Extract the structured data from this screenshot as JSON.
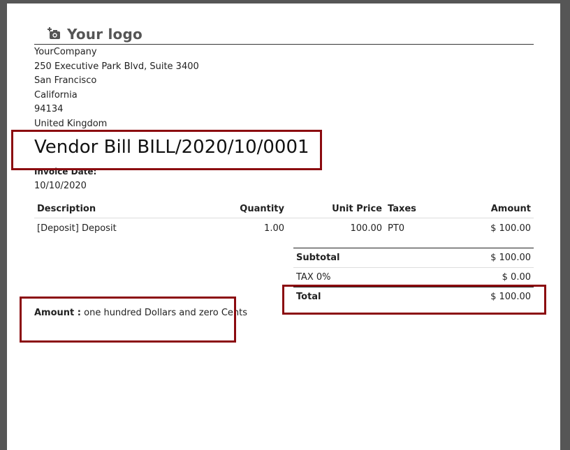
{
  "logo": {
    "text": "Your logo",
    "icon": "camera-plus-icon"
  },
  "company": {
    "lines": [
      "YourCompany",
      "250 Executive Park Blvd, Suite 3400",
      "San Francisco",
      "California",
      "94134",
      "United Kingdom"
    ]
  },
  "bill": {
    "title": "Vendor Bill BILL/2020/10/0001",
    "date_label": "Invoice Date:",
    "date_value": "10/10/2020"
  },
  "table": {
    "headers": [
      "Description",
      "Quantity",
      "Unit Price",
      "Taxes",
      "Amount"
    ],
    "rows": [
      {
        "description": "[Deposit] Deposit",
        "quantity": "1.00",
        "unit_price": "100.00",
        "taxes": "PT0",
        "amount": "$ 100.00"
      }
    ]
  },
  "totals": {
    "subtotal_label": "Subtotal",
    "subtotal_value": "$ 100.00",
    "tax_label": "TAX 0%",
    "tax_value": "$ 0.00",
    "total_label": "Total",
    "total_value": "$ 100.00"
  },
  "amount_in_words": {
    "label": "Amount :",
    "text": " one hundred Dollars and zero Cents"
  },
  "colors": {
    "highlight": "#8b0a0f",
    "background": "#565656"
  }
}
